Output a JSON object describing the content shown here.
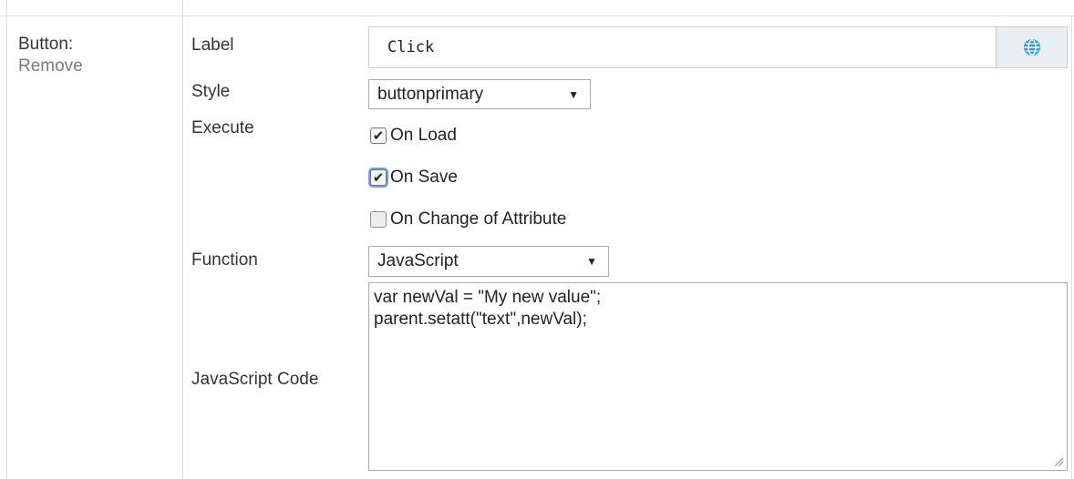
{
  "section": {
    "title": "Button:",
    "remove_label": "Remove"
  },
  "fields": {
    "label": {
      "label": "Label",
      "value": "Click",
      "globe_icon": "globe-icon"
    },
    "style": {
      "label": "Style",
      "selected": "buttonprimary"
    },
    "execute": {
      "label": "Execute",
      "options": [
        {
          "label": "On Load",
          "checked": true
        },
        {
          "label": "On Save",
          "checked": true
        },
        {
          "label": "On Change of Attribute",
          "checked": false
        }
      ]
    },
    "function": {
      "label": "Function",
      "selected": "JavaScript"
    },
    "code": {
      "label": "JavaScript Code",
      "value": "var newVal = \"My new value\";\nparent.setatt(\"text\",newVal);"
    }
  },
  "colors": {
    "globe": "#2f9ad8",
    "border": "#cccccc",
    "focus": "#6f9fe0"
  }
}
